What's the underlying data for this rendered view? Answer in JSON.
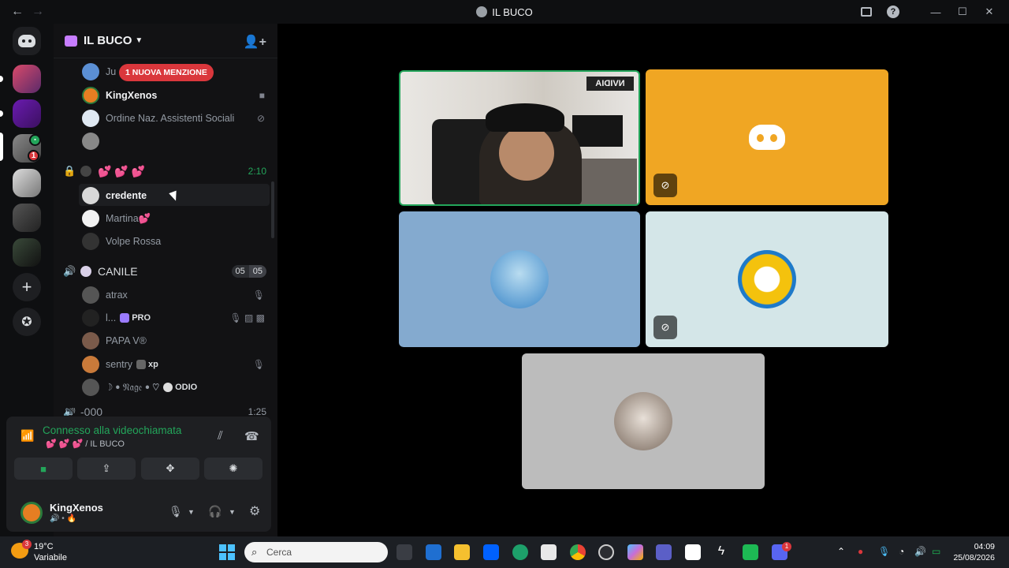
{
  "window": {
    "title": "IL BUCO"
  },
  "server": {
    "name": "IL BUCO"
  },
  "mention_banner": "1 NUOVA MENZIONE",
  "members_top": [
    {
      "name": "Ju",
      "color": "#5b8fd4"
    },
    {
      "name": "KingXenos",
      "color": "#e67e22"
    },
    {
      "name": "Ordine Naz. Assistenti Sociali",
      "color": "#dfe8f2"
    },
    {
      "name": "",
      "color": "#888888"
    }
  ],
  "voice_channel_1": {
    "name": "💕 💕 💕",
    "time": "2:10"
  },
  "members_vc1": [
    {
      "name": "credente",
      "color": "#d8d8d8"
    },
    {
      "name": "Martina💕",
      "color": "#f2f2f2"
    },
    {
      "name": "Volpe Rossa",
      "color": "#333333"
    }
  ],
  "voice_channel_2": {
    "name": "CANILE",
    "count_a": "05",
    "count_b": "05"
  },
  "members_vc2": [
    {
      "name": "atrax",
      "tag": ""
    },
    {
      "name": "l...",
      "tag": "PRO"
    },
    {
      "name": "PAPA V®",
      "tag": ""
    },
    {
      "name": "sentry",
      "tag": "xp"
    },
    {
      "name": "☽ ꔷ 𝔑𝔞𝔤𝔢 ꔷ ♡",
      "tag": "ODIO"
    }
  ],
  "next_channel": {
    "name": "-000",
    "time": "1:25"
  },
  "rtc": {
    "status": "Connesso alla videochiamata",
    "sub": "💕 💕 💕 / IL BUCO"
  },
  "user": {
    "name": "KingXenos",
    "status": "🔊 • 🔥"
  },
  "taskbar": {
    "temp": "19°C",
    "weather": "Variabile",
    "weather_badge": "3",
    "search_placeholder": "Cerca",
    "time": "04:09",
    "date": "25/08/2026",
    "discord_badge": "1"
  },
  "camera_sign": "NVIDIA",
  "colors": {
    "accent_green": "#23a55a",
    "danger": "#da373c",
    "tile_orange": "#f0a623"
  }
}
